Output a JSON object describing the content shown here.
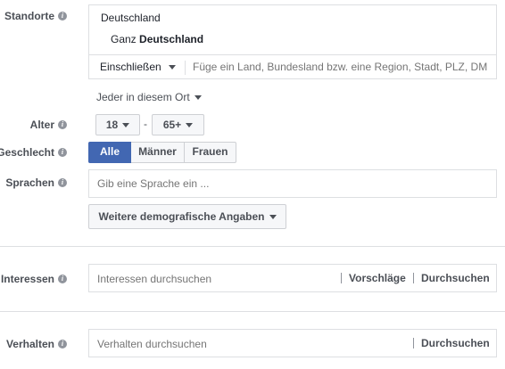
{
  "locations": {
    "label": "Standorte",
    "country": "Deutschland",
    "whole_prefix": "Ganz",
    "whole_country": "Deutschland",
    "include_label": "Einschließen",
    "search_placeholder": "Füge ein Land, Bundesland bzw. eine Region, Stadt, PLZ, DMA",
    "people_filter": "Jeder in diesem Ort"
  },
  "age": {
    "label": "Alter",
    "min": "18",
    "separator": "-",
    "max": "65+"
  },
  "gender": {
    "label": "Geschlecht",
    "options": [
      "Alle",
      "Männer",
      "Frauen"
    ],
    "selected": "Alle"
  },
  "languages": {
    "label": "Sprachen",
    "placeholder": "Gib eine Sprache ein ..."
  },
  "demographics_button": "Weitere demografische Angaben",
  "interests": {
    "label": "Interessen",
    "placeholder": "Interessen durchsuchen",
    "suggestions": "Vorschläge",
    "browse": "Durchsuchen"
  },
  "behaviors": {
    "label": "Verhalten",
    "placeholder": "Verhalten durchsuchen",
    "browse": "Durchsuchen"
  },
  "colors": {
    "selected_bg": "#4267b2",
    "border": "#dddfe2",
    "label_text": "#4b4f56"
  }
}
